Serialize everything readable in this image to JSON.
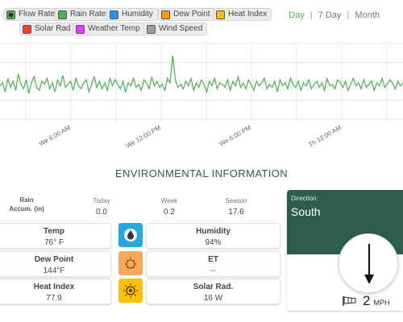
{
  "legend": [
    {
      "label": "Flow Rate",
      "color": "#4caf50",
      "checked": true
    },
    {
      "label": "Rain Rate",
      "color": "#4caf50",
      "checked": false
    },
    {
      "label": "Humidity",
      "color": "#2196f3",
      "checked": false
    },
    {
      "label": "Dew Point",
      "color": "#ff9800",
      "checked": false
    },
    {
      "label": "Heat Index",
      "color": "#ffc107",
      "checked": false
    },
    {
      "label": "Solar Rad",
      "color": "#f44336",
      "checked": false
    },
    {
      "label": "Weather Temp",
      "color": "#e040fb",
      "checked": false
    },
    {
      "label": "Wind Speed",
      "color": "#9e9e9e",
      "checked": false
    }
  ],
  "range_selector": {
    "day": "Day",
    "week": "7 Day",
    "month": "Month",
    "separator": "|",
    "active": "Day"
  },
  "chart_data": {
    "type": "line",
    "series": [
      {
        "name": "Flow Rate",
        "color": "#4caf50"
      }
    ],
    "x_ticks": [
      "We 6:00 AM",
      "We 12:00 PM",
      "We 6:00 PM",
      "Th 12:00 AM"
    ],
    "grid": true,
    "values": [
      42,
      44,
      38,
      47,
      41,
      45,
      39,
      50,
      43,
      40,
      46,
      37,
      44,
      48,
      41,
      39,
      45,
      43,
      47,
      40,
      44,
      38,
      46,
      42,
      49,
      41,
      43,
      45,
      39,
      47,
      42,
      40,
      44,
      46,
      38,
      43,
      48,
      41,
      45,
      40,
      44,
      39,
      47,
      42,
      46,
      43,
      40,
      45,
      38,
      44,
      42,
      47,
      41,
      43,
      39,
      46,
      44,
      40,
      48,
      42,
      45,
      41,
      43,
      39,
      47,
      44,
      62,
      46,
      41,
      43,
      40,
      45,
      42,
      47,
      39,
      44,
      41,
      46,
      43,
      38,
      45,
      42,
      47,
      40,
      44,
      43,
      41,
      46,
      39,
      45,
      42,
      48,
      41,
      44,
      40,
      46,
      43,
      39,
      45,
      42,
      44,
      47,
      40,
      43,
      41,
      45,
      38,
      46,
      42,
      44,
      40,
      47,
      43,
      41,
      45,
      39,
      44,
      42,
      46,
      40,
      43,
      45,
      41,
      44,
      39,
      47,
      42,
      43,
      40,
      46,
      44,
      41,
      45,
      39,
      43,
      47,
      42,
      44,
      40,
      46,
      41,
      43,
      45,
      39,
      44,
      42,
      47,
      41,
      43,
      46,
      44,
      40,
      45,
      42,
      44
    ]
  },
  "section_title": "ENVIRONMENTAL INFORMATION",
  "rain": {
    "label_line1": "Rain",
    "label_line2": "Accum. (in)",
    "columns": [
      {
        "header": "Today",
        "value": "0.0"
      },
      {
        "header": "Week",
        "value": "0.2"
      },
      {
        "header": "Season",
        "value": "17.6"
      }
    ]
  },
  "metrics": {
    "temp": {
      "title": "Temp",
      "value": "76° F"
    },
    "dew_point": {
      "title": "Dew Point",
      "value": "144°F"
    },
    "heat_index": {
      "title": "Heat Index",
      "value": "77.9"
    },
    "humidity": {
      "title": "Humidity",
      "value": "94%"
    },
    "et": {
      "title": "ET",
      "value": "--"
    },
    "solar_rad": {
      "title": "Solar Rad.",
      "value": "16 W"
    }
  },
  "icons": {
    "humidity": {
      "name": "water-drop-icon",
      "bg": "#29a8e0"
    },
    "et": {
      "name": "sun-et-icon",
      "bg": "#f7a859"
    },
    "solar": {
      "name": "sun-icon",
      "bg": "#ffc107"
    }
  },
  "direction": {
    "label": "Direction:",
    "value": "South",
    "bg": "#2e5d4b",
    "speed": "2",
    "unit": "MPH"
  }
}
